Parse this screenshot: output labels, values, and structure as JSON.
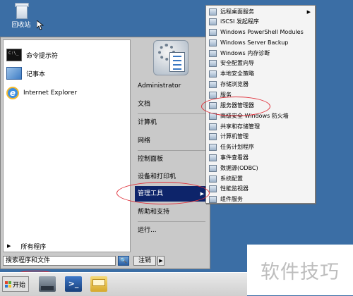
{
  "desktop": {
    "recycle_bin_label": "回收站"
  },
  "start_menu": {
    "pinned": [
      {
        "label": "命令提示符",
        "icon": "command-prompt-icon"
      },
      {
        "label": "记事本",
        "icon": "notepad-icon"
      },
      {
        "label": "Internet Explorer",
        "icon": "internet-explorer-icon"
      }
    ],
    "all_programs": "所有程序",
    "search_placeholder": "搜索程序和文件",
    "log_off": "注销",
    "right_items": {
      "administrator": "Administrator",
      "documents": "文档",
      "computer": "计算机",
      "network": "网络",
      "control_panel": "控制面板",
      "devices_printers": "设备和打印机",
      "admin_tools": "管理工具",
      "help": "帮助和支持",
      "run": "运行..."
    }
  },
  "admin_tools_menu": [
    {
      "label": "远程桌面服务",
      "has_submenu": true
    },
    {
      "label": "iSCSI 发起程序"
    },
    {
      "label": "Windows PowerShell Modules"
    },
    {
      "label": "Windows Server Backup"
    },
    {
      "label": "Windows 内存诊断"
    },
    {
      "label": "安全配置向导"
    },
    {
      "label": "本地安全策略"
    },
    {
      "label": "存储浏览器"
    },
    {
      "label": "服务"
    },
    {
      "label": "服务器管理器"
    },
    {
      "label": "高级安全 Windows 防火墙"
    },
    {
      "label": "共享和存储管理"
    },
    {
      "label": "计算机管理"
    },
    {
      "label": "任务计划程序"
    },
    {
      "label": "事件查看器"
    },
    {
      "label": "数据源(ODBC)"
    },
    {
      "label": "系统配置"
    },
    {
      "label": "性能监视器"
    },
    {
      "label": "组件服务"
    }
  ],
  "taskbar": {
    "start_label": "开始",
    "pinned": [
      "server-manager-icon",
      "powershell-icon",
      "explorer-icon"
    ]
  },
  "watermark": "软件技巧",
  "colors": {
    "desktop": "#3b6ea5",
    "highlight": "#0d246a",
    "annotation": "#e0303a"
  }
}
